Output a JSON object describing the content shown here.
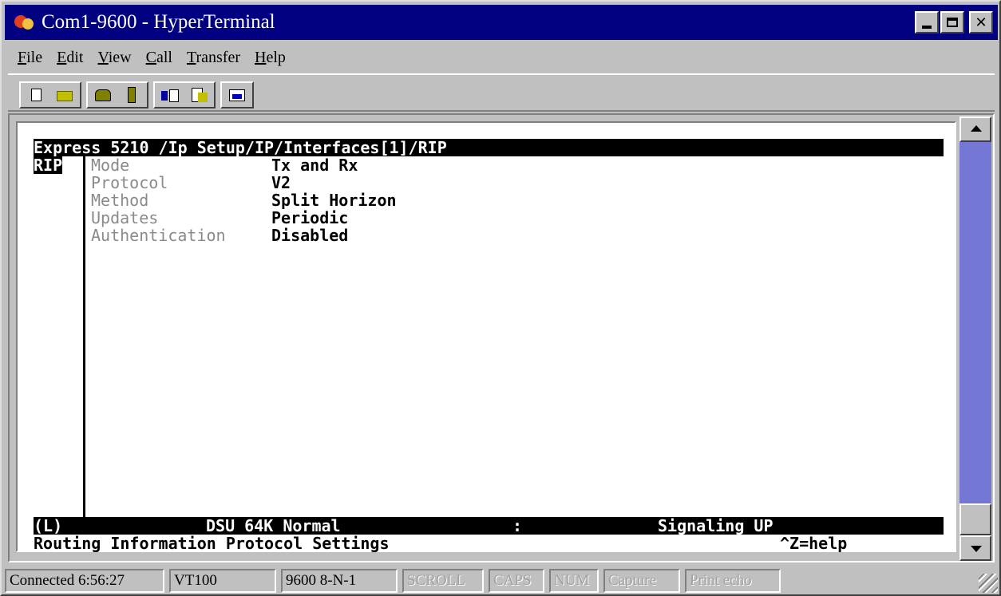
{
  "window": {
    "title": "Com1-9600 - HyperTerminal"
  },
  "menu": {
    "items": [
      {
        "first": "F",
        "rest": "ile"
      },
      {
        "first": "E",
        "rest": "dit"
      },
      {
        "first": "V",
        "rest": "iew"
      },
      {
        "first": "C",
        "rest": "all"
      },
      {
        "first": "T",
        "rest": "ransfer"
      },
      {
        "first": "H",
        "rest": "elp"
      }
    ]
  },
  "toolbar": {
    "icons": [
      "new-icon",
      "open-icon",
      "connect-icon",
      "disconnect-icon",
      "send-icon",
      "receive-icon",
      "properties-icon"
    ]
  },
  "terminal": {
    "header": "Express 5210 /Ip Setup/IP/Interfaces[1]/RIP",
    "section_label": "RIP",
    "fields": [
      {
        "name": "Mode",
        "value": "Tx and Rx"
      },
      {
        "name": "Protocol",
        "value": "V2"
      },
      {
        "name": "Method",
        "value": "Split Horizon"
      },
      {
        "name": "Updates",
        "value": "Periodic"
      },
      {
        "name": "Authentication",
        "value": "Disabled"
      }
    ],
    "status_line": {
      "left": "(L)",
      "mid": "DSU 64K Normal",
      "sep": ":",
      "right": "Signaling UP"
    },
    "footer": "Routing Information Protocol Settings",
    "help_hint": "^Z=help"
  },
  "statusbar": {
    "connected": "Connected 6:56:27",
    "emulation": "VT100",
    "settings": "9600 8-N-1",
    "scroll": "SCROLL",
    "caps": "CAPS",
    "num": "NUM",
    "capture": "Capture",
    "print_echo": "Print echo"
  },
  "colors": {
    "titlebar": "#000080",
    "face": "#c0c0c0",
    "scroll_track": "#7478d4",
    "dim_text": "#8a8a8a"
  }
}
